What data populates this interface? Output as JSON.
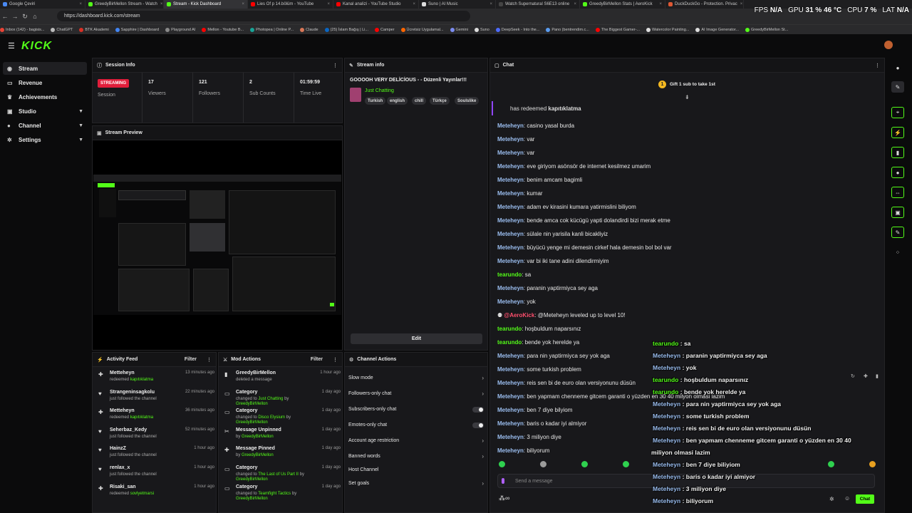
{
  "browser": {
    "tabs": [
      {
        "title": "Google Çeviri",
        "color": "#4a8af4",
        "active": false
      },
      {
        "title": "GreedyBirMellon Stream - Watch",
        "color": "#53fc18",
        "active": false
      },
      {
        "title": "Stream - Kick Dashboard",
        "color": "#53fc18",
        "active": true
      },
      {
        "title": "Lies Of p 14.bölüm - YouTube",
        "color": "#ff0000",
        "active": false
      },
      {
        "title": "Kanal analizi - YouTube Studio",
        "color": "#ff0000",
        "active": false
      },
      {
        "title": "Suno | AI Music",
        "color": "#dddddd",
        "active": false
      },
      {
        "title": "Watch Supernatural S6E13 online",
        "color": "#444444",
        "active": false
      },
      {
        "title": "GreedyBirMellon Stats | AeroKick",
        "color": "#53fc18",
        "active": false
      },
      {
        "title": "DuckDuckGo - Protection. Privac",
        "color": "#de5833",
        "active": false
      }
    ],
    "url": "https://dashboard.kick.com/stream",
    "bookmarks": [
      {
        "label": "Inbox (142) - bagisis...",
        "color": "#ea4335"
      },
      {
        "label": "ChatGPT",
        "color": "#bbbbbb"
      },
      {
        "label": "BTK Akademi",
        "color": "#d93025"
      },
      {
        "label": "Sapphire | Dashboard",
        "color": "#4285f4"
      },
      {
        "label": "Playground AI",
        "color": "#888888"
      },
      {
        "label": "Mellon - Youtube B...",
        "color": "#ff0000"
      },
      {
        "label": "Photopea | Online P...",
        "color": "#18a497"
      },
      {
        "label": "Claude",
        "color": "#d97757"
      },
      {
        "label": "(25) İslam Bağış | Li...",
        "color": "#0a66c2"
      },
      {
        "label": "Camper",
        "color": "#ff0000"
      },
      {
        "label": "Ücretsiz Uygulamal...",
        "color": "#ff6600"
      },
      {
        "label": "Gemini",
        "color": "#7b8cf0"
      },
      {
        "label": "Suno",
        "color": "#dddddd"
      },
      {
        "label": "DeepSeek - Into the...",
        "color": "#4d6bfe"
      },
      {
        "label": "Pano (bentrendim.c...",
        "color": "#5a9cf0"
      },
      {
        "label": "The Biggest Gamer-...",
        "color": "#ff0000"
      },
      {
        "label": "Watercolor Painting...",
        "color": "#dddddd"
      },
      {
        "label": "AI Image Generator...",
        "color": "#dddddd"
      },
      {
        "label": "GreedyBirMellon St...",
        "color": "#53fc18"
      }
    ],
    "overlay": {
      "fps_label": "FPS",
      "fps": "N/A",
      "gpu_label": "GPU",
      "gpu": "31 %  46 °C",
      "cpu_label": "CPU",
      "cpu": "7 %",
      "lat_label": "LAT",
      "lat": "N/A"
    }
  },
  "brand": {
    "logo": "KICK",
    "accent": "#53fc18"
  },
  "sidebar": {
    "items": [
      {
        "label": "Stream",
        "icon": "broadcast-icon"
      },
      {
        "label": "Revenue",
        "icon": "wallet-icon"
      },
      {
        "label": "Achievements",
        "icon": "trophy-icon"
      },
      {
        "label": "Studio",
        "icon": "camera-icon"
      },
      {
        "label": "Channel",
        "icon": "user-icon"
      },
      {
        "label": "Settings",
        "icon": "gear-icon"
      }
    ]
  },
  "session": {
    "title": "Session Info",
    "badge": "STREAMING",
    "badge_label": "Session",
    "stats": [
      {
        "value": "17",
        "label": "Viewers"
      },
      {
        "value": "121",
        "label": "Followers"
      },
      {
        "value": "2",
        "label": "Sub Counts"
      },
      {
        "value": "01:59:59",
        "label": "Time Live"
      }
    ]
  },
  "stream_info": {
    "title": "Stream info",
    "stream_title": "GOOOOH VERY DELİCİOUS - - Düzenli Yayınlar!!!",
    "category": "Just Chatting",
    "tags": [
      "Turkish",
      "english",
      "chill",
      "Türkçe",
      "Soulslike"
    ],
    "edit": "Edit"
  },
  "preview": {
    "title": "Stream Preview"
  },
  "activity": {
    "title": "Activity Feed",
    "filter": "Filter",
    "items": [
      {
        "name": "Metteheyn",
        "sub": "redeemed",
        "target": "kapıtıklatma",
        "time": "13 minutes ago"
      },
      {
        "name": "Strangeninsagkolu",
        "sub": "just followed the channel",
        "target": "",
        "time": "22 minutes ago"
      },
      {
        "name": "Metteheyn",
        "sub": "redeemed",
        "target": "kapıtıklatma",
        "time": "36 minutes ago"
      },
      {
        "name": "Seherbaz_Kedy",
        "sub": "just followed the channel",
        "target": "",
        "time": "52 minutes ago"
      },
      {
        "name": "HainzZ",
        "sub": "just followed the channel",
        "target": "",
        "time": "1 hour ago"
      },
      {
        "name": "renlax_x",
        "sub": "just followed the channel",
        "target": "",
        "time": "1 hour ago"
      },
      {
        "name": "Risaki_san",
        "sub": "redeemed",
        "target": "sovlyetmarsi",
        "time": "1 hour ago"
      }
    ]
  },
  "mod_actions": {
    "title": "Mod Actions",
    "filter": "Filter",
    "items": [
      {
        "name": "GreedyBirMellon",
        "line1": "deleted a message",
        "g1": "",
        "line2": "",
        "g2": "",
        "time": "1 hour ago"
      },
      {
        "name": "Category",
        "line1": "changed to",
        "g1": "Just Chatting",
        "line2": "by",
        "g2": "GreedyBirMellon",
        "time": "1 day ago"
      },
      {
        "name": "Category",
        "line1": "changed to",
        "g1": "Disco Elysium",
        "line2": "by",
        "g2": "GreedyBirMellon",
        "time": "1 day ago"
      },
      {
        "name": "Message Unpinned",
        "line1": "by",
        "g1": "GreedyBirMellon",
        "line2": "",
        "g2": "",
        "time": "1 day ago"
      },
      {
        "name": "Message Pinned",
        "line1": "by",
        "g1": "GreedyBirMellon",
        "line2": "",
        "g2": "",
        "time": "1 day ago"
      },
      {
        "name": "Category",
        "line1": "changed to",
        "g1": "The Last of Us Part II",
        "line2": "by",
        "g2": "GreedyBirMellon",
        "time": "1 day ago"
      },
      {
        "name": "Category",
        "line1": "changed to",
        "g1": "Teamfight Tactics",
        "line2": "by",
        "g2": "GreedyBirMellon",
        "time": "1 day ago"
      }
    ]
  },
  "channel_actions": {
    "title": "Channel Actions",
    "items": [
      {
        "label": "Slow mode",
        "kind": "chevron"
      },
      {
        "label": "Followers-only chat",
        "kind": "chevron"
      },
      {
        "label": "Subscribers-only chat",
        "kind": "toggle"
      },
      {
        "label": "Emotes-only chat",
        "kind": "toggle"
      },
      {
        "label": "Account age restriction",
        "kind": "chevron"
      },
      {
        "label": "Banned words",
        "kind": "chevron"
      },
      {
        "label": "Host Channel",
        "kind": "none"
      },
      {
        "label": "Set goals",
        "kind": "chevron"
      }
    ]
  },
  "chat": {
    "title": "Chat",
    "gift": "Gift 1 sub to take 1st",
    "gift_coin": "1",
    "redeem_text": "has redeemed",
    "redeem_target": "kapıtıklatma",
    "messages": [
      {
        "user": "Meteheyn",
        "color": "#9bbef0",
        "text": "casino yasal burda"
      },
      {
        "user": "Meteheyn",
        "color": "#9bbef0",
        "text": "var"
      },
      {
        "user": "Meteheyn",
        "color": "#9bbef0",
        "text": "var"
      },
      {
        "user": "Meteheyn",
        "color": "#9bbef0",
        "text": "eve giriyom asönsör de internet kesilmez umarim"
      },
      {
        "user": "Meteheyn",
        "color": "#9bbef0",
        "text": "benim amcam bagimli"
      },
      {
        "user": "Meteheyn",
        "color": "#9bbef0",
        "text": "kumar"
      },
      {
        "user": "Meteheyn",
        "color": "#9bbef0",
        "text": "adam ev kirasini kumara yatirmislini biliyom"
      },
      {
        "user": "Meteheyn",
        "color": "#9bbef0",
        "text": "bende amca cok kücügü yapti dolandirdi bizi merak etme"
      },
      {
        "user": "Meteheyn",
        "color": "#9bbef0",
        "text": "sülale nin yarisila kanli bicakliyiz"
      },
      {
        "user": "Meteheyn",
        "color": "#9bbef0",
        "text": "büyücü yenge mi demesin cirkef hala demesin bol bol var"
      },
      {
        "user": "Meteheyn",
        "color": "#9bbef0",
        "text": "var bi iki tane adini dilendirmiyim"
      },
      {
        "user": "tearundo",
        "color": "#53fc18",
        "text": "sa"
      },
      {
        "user": "Meteheyn",
        "color": "#9bbef0",
        "text": "paranin yaptirmiyca sey aga"
      },
      {
        "user": "Meteheyn",
        "color": "#9bbef0",
        "text": "yok"
      },
      {
        "user": "@AeroKick",
        "color": "#ff4f6d",
        "text": "@Meteheyn leveled up to level 10!"
      },
      {
        "user": "tearundo",
        "color": "#53fc18",
        "text": "hoşbuldum naparsınız"
      },
      {
        "user": "tearundo",
        "color": "#53fc18",
        "text": "bende yok herelde ya"
      },
      {
        "user": "Meteheyn",
        "color": "#9bbef0",
        "text": "para nin yaptirmiyca sey yok aga"
      },
      {
        "user": "Meteheyn",
        "color": "#9bbef0",
        "text": "some turkish problem"
      },
      {
        "user": "Meteheyn",
        "color": "#9bbef0",
        "text": "reis sen bi de euro olan versiyonunu düsün"
      },
      {
        "user": "Meteheyn",
        "color": "#9bbef0",
        "text": "ben yapmam chenneme gitcem garanti o yüzden en 30 40 milyon olmasi lazim"
      },
      {
        "user": "Meteheyn",
        "color": "#9bbef0",
        "text": "ben 7 diye bilyiom"
      },
      {
        "user": "Meteheyn",
        "color": "#9bbef0",
        "text": "baris o kadar iyi almiyor"
      },
      {
        "user": "Meteheyn",
        "color": "#9bbef0",
        "text": "3 miliyon diye"
      },
      {
        "user": "Meteheyn",
        "color": "#9bbef0",
        "text": "biliyorum"
      }
    ],
    "send_placeholder": "Send a message",
    "send_button": "Chat"
  },
  "overlay_chat": [
    {
      "user": "tearundo",
      "green": true,
      "text": "sa"
    },
    {
      "user": "Meteheyn",
      "green": false,
      "text": "paranin yaptirmiyca sey aga"
    },
    {
      "user": "Meteheyn",
      "green": false,
      "text": "yok"
    },
    {
      "user": "tearundo",
      "green": true,
      "text": "hoşbuldum naparsınız"
    },
    {
      "user": "tearundo",
      "green": true,
      "text": "bende yok herelde ya"
    },
    {
      "user": "Meteheyn",
      "green": false,
      "text": "para nin yaptirmiyca sey yok aga"
    },
    {
      "user": "Meteheyn",
      "green": false,
      "text": "some turkish problem"
    },
    {
      "user": "Meteheyn",
      "green": false,
      "text": "reis sen bi de euro olan versiyonunu düsün"
    },
    {
      "user": "Meteheyn",
      "green": false,
      "text": "ben yapmam chenneme gitcem garanti o yüzden en 30 40"
    },
    {
      "user": "",
      "green": false,
      "text": "miliyon olmasi lazim"
    },
    {
      "user": "Meteheyn",
      "green": false,
      "text": "ben 7 diye biliyiom"
    },
    {
      "user": "Meteheyn",
      "green": false,
      "text": "baris o kadar iyi almiyor"
    },
    {
      "user": "Meteheyn",
      "green": false,
      "text": "3 miliyon diye"
    },
    {
      "user": "Meteheyn",
      "green": false,
      "text": "biliyorum"
    }
  ]
}
